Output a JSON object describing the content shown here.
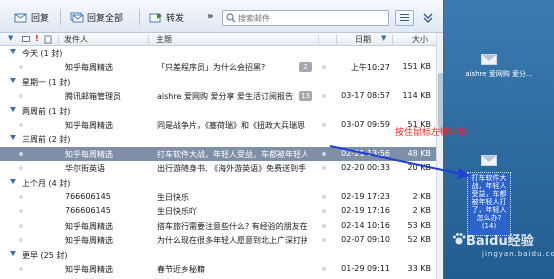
{
  "toolbar": {
    "reply_label": "回复",
    "reply_all_label": "回复全部",
    "forward_label": "转发",
    "more_label": "»",
    "search_placeholder": "搜索邮件"
  },
  "columns": {
    "sender": "发件人",
    "subject": "主题",
    "date": "日期",
    "size": "大小"
  },
  "groups": [
    {
      "label": "今天 (1 封)",
      "mails": [
        {
          "from": "知乎每周精选",
          "subject": "「只差程序员」为什么会招黑?",
          "badge": "2",
          "date": "上午10:27",
          "size": "151 KB"
        }
      ]
    },
    {
      "label": "星期一 (1 封)",
      "mails": [
        {
          "from": "腾讯邮箱管理员",
          "subject": "aishre 爱网购 爱分享 爱生活订阅报告",
          "badge": "13",
          "date": "03-17 08:57",
          "size": "114 KB"
        }
      ]
    },
    {
      "label": "两周前 (1 封)",
      "mails": [
        {
          "from": "知乎每周精选",
          "subject": "同是战争片，《塞荷瑞》和《扭政大兵瑞恩",
          "badge": "",
          "date": "03-07 09:59",
          "size": "51 KB"
        }
      ]
    },
    {
      "label": "三周前 (2 封)",
      "mails": [
        {
          "from": "知乎每周精选",
          "subject": "打车软件大战，年轻人受益，车都被年轻人",
          "badge": "",
          "date": "02-21 13:56",
          "size": "48 KB",
          "selected": true
        },
        {
          "from": "华尔街英语",
          "subject": "出行游随身书, 《海外游英语》免费送到手",
          "badge": "",
          "date": "02-20 00:33",
          "size": "20 KB"
        }
      ]
    },
    {
      "label": "上个月 (4 封)",
      "mails": [
        {
          "from": "766606145",
          "subject": "生日快乐",
          "badge": "",
          "date": "02-19 17:23",
          "size": "2 KB"
        },
        {
          "from": "766606145",
          "subject": "生日快乐吖",
          "badge": "",
          "date": "02-19 17:16",
          "size": "2 KB"
        },
        {
          "from": "知乎每周精选",
          "subject": "搭车旅行需要注意些什么? 有经验的朋友在",
          "badge": "",
          "date": "02-14 10:16",
          "size": "53 KB"
        },
        {
          "from": "知乎每周精选",
          "subject": "为什么现在很多年轻人愿意到北上广深打拼",
          "badge": "",
          "date": "02-07 09:10",
          "size": "52 KB"
        }
      ]
    },
    {
      "label": "更早 (25 封)",
      "mails": [
        {
          "from": "知乎每周精选",
          "subject": "春节近乡秘籍",
          "badge": "",
          "date": "01-29 09:11",
          "size": "33 KB"
        }
      ]
    }
  ],
  "desktop": {
    "icon1_label": "aishre 爱网购 爱分...",
    "drag_label": "打车软件大战，年轻人受益，车都被年轻人打了，年轻人怎么办? (14)",
    "annotation": "按住鼠标左键拖到"
  },
  "watermark": {
    "brand": "Baidu经验",
    "sub": "jingyan.baidu.com"
  },
  "colors": {
    "selected_row": "#7f8fa8",
    "annotation": "#e8261c",
    "arrow": "#1f3fd6"
  }
}
